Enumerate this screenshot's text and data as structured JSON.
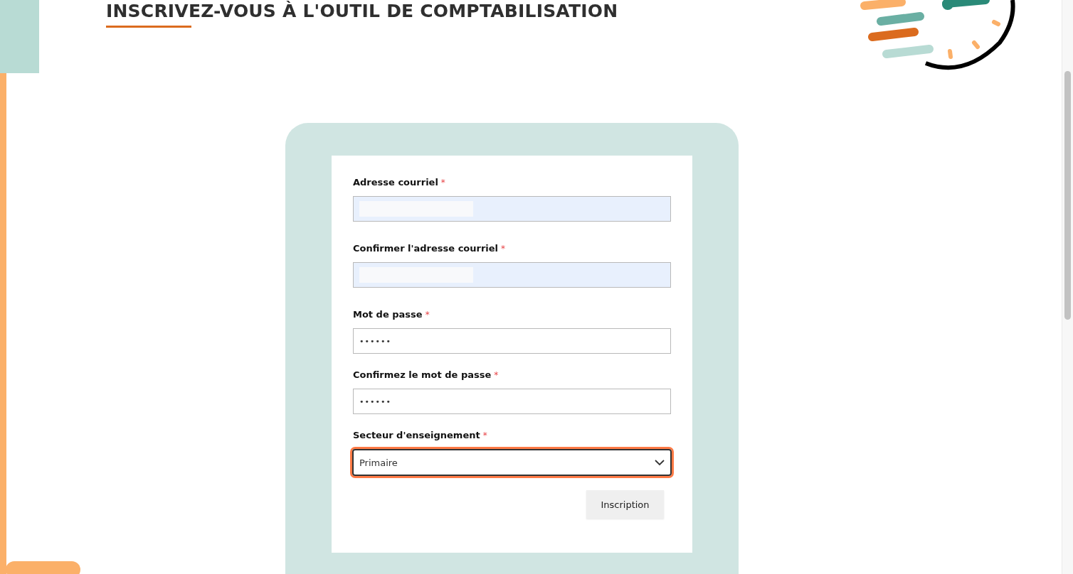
{
  "page_title": "INSCRIVEZ-VOUS À L'OUTIL DE COMPTABILISATION",
  "form": {
    "fields": [
      {
        "kind": "text",
        "label": "Adresse courriel",
        "required_mark": "*",
        "autofilled": true
      },
      {
        "kind": "text",
        "label": "Confirmer l'adresse courriel",
        "required_mark": "*",
        "autofilled": true
      },
      {
        "kind": "password",
        "label": "Mot de passe",
        "required_mark": "*",
        "value": "••••••",
        "autofilled": false
      },
      {
        "kind": "password",
        "label": "Confirmez le mot de passe",
        "required_mark": "*",
        "value": "••••••",
        "autofilled": false
      },
      {
        "kind": "select",
        "label": "Secteur d'enseignement",
        "required_mark": "*",
        "value": "Primaire",
        "focused": true
      }
    ],
    "submit": "Inscription"
  }
}
